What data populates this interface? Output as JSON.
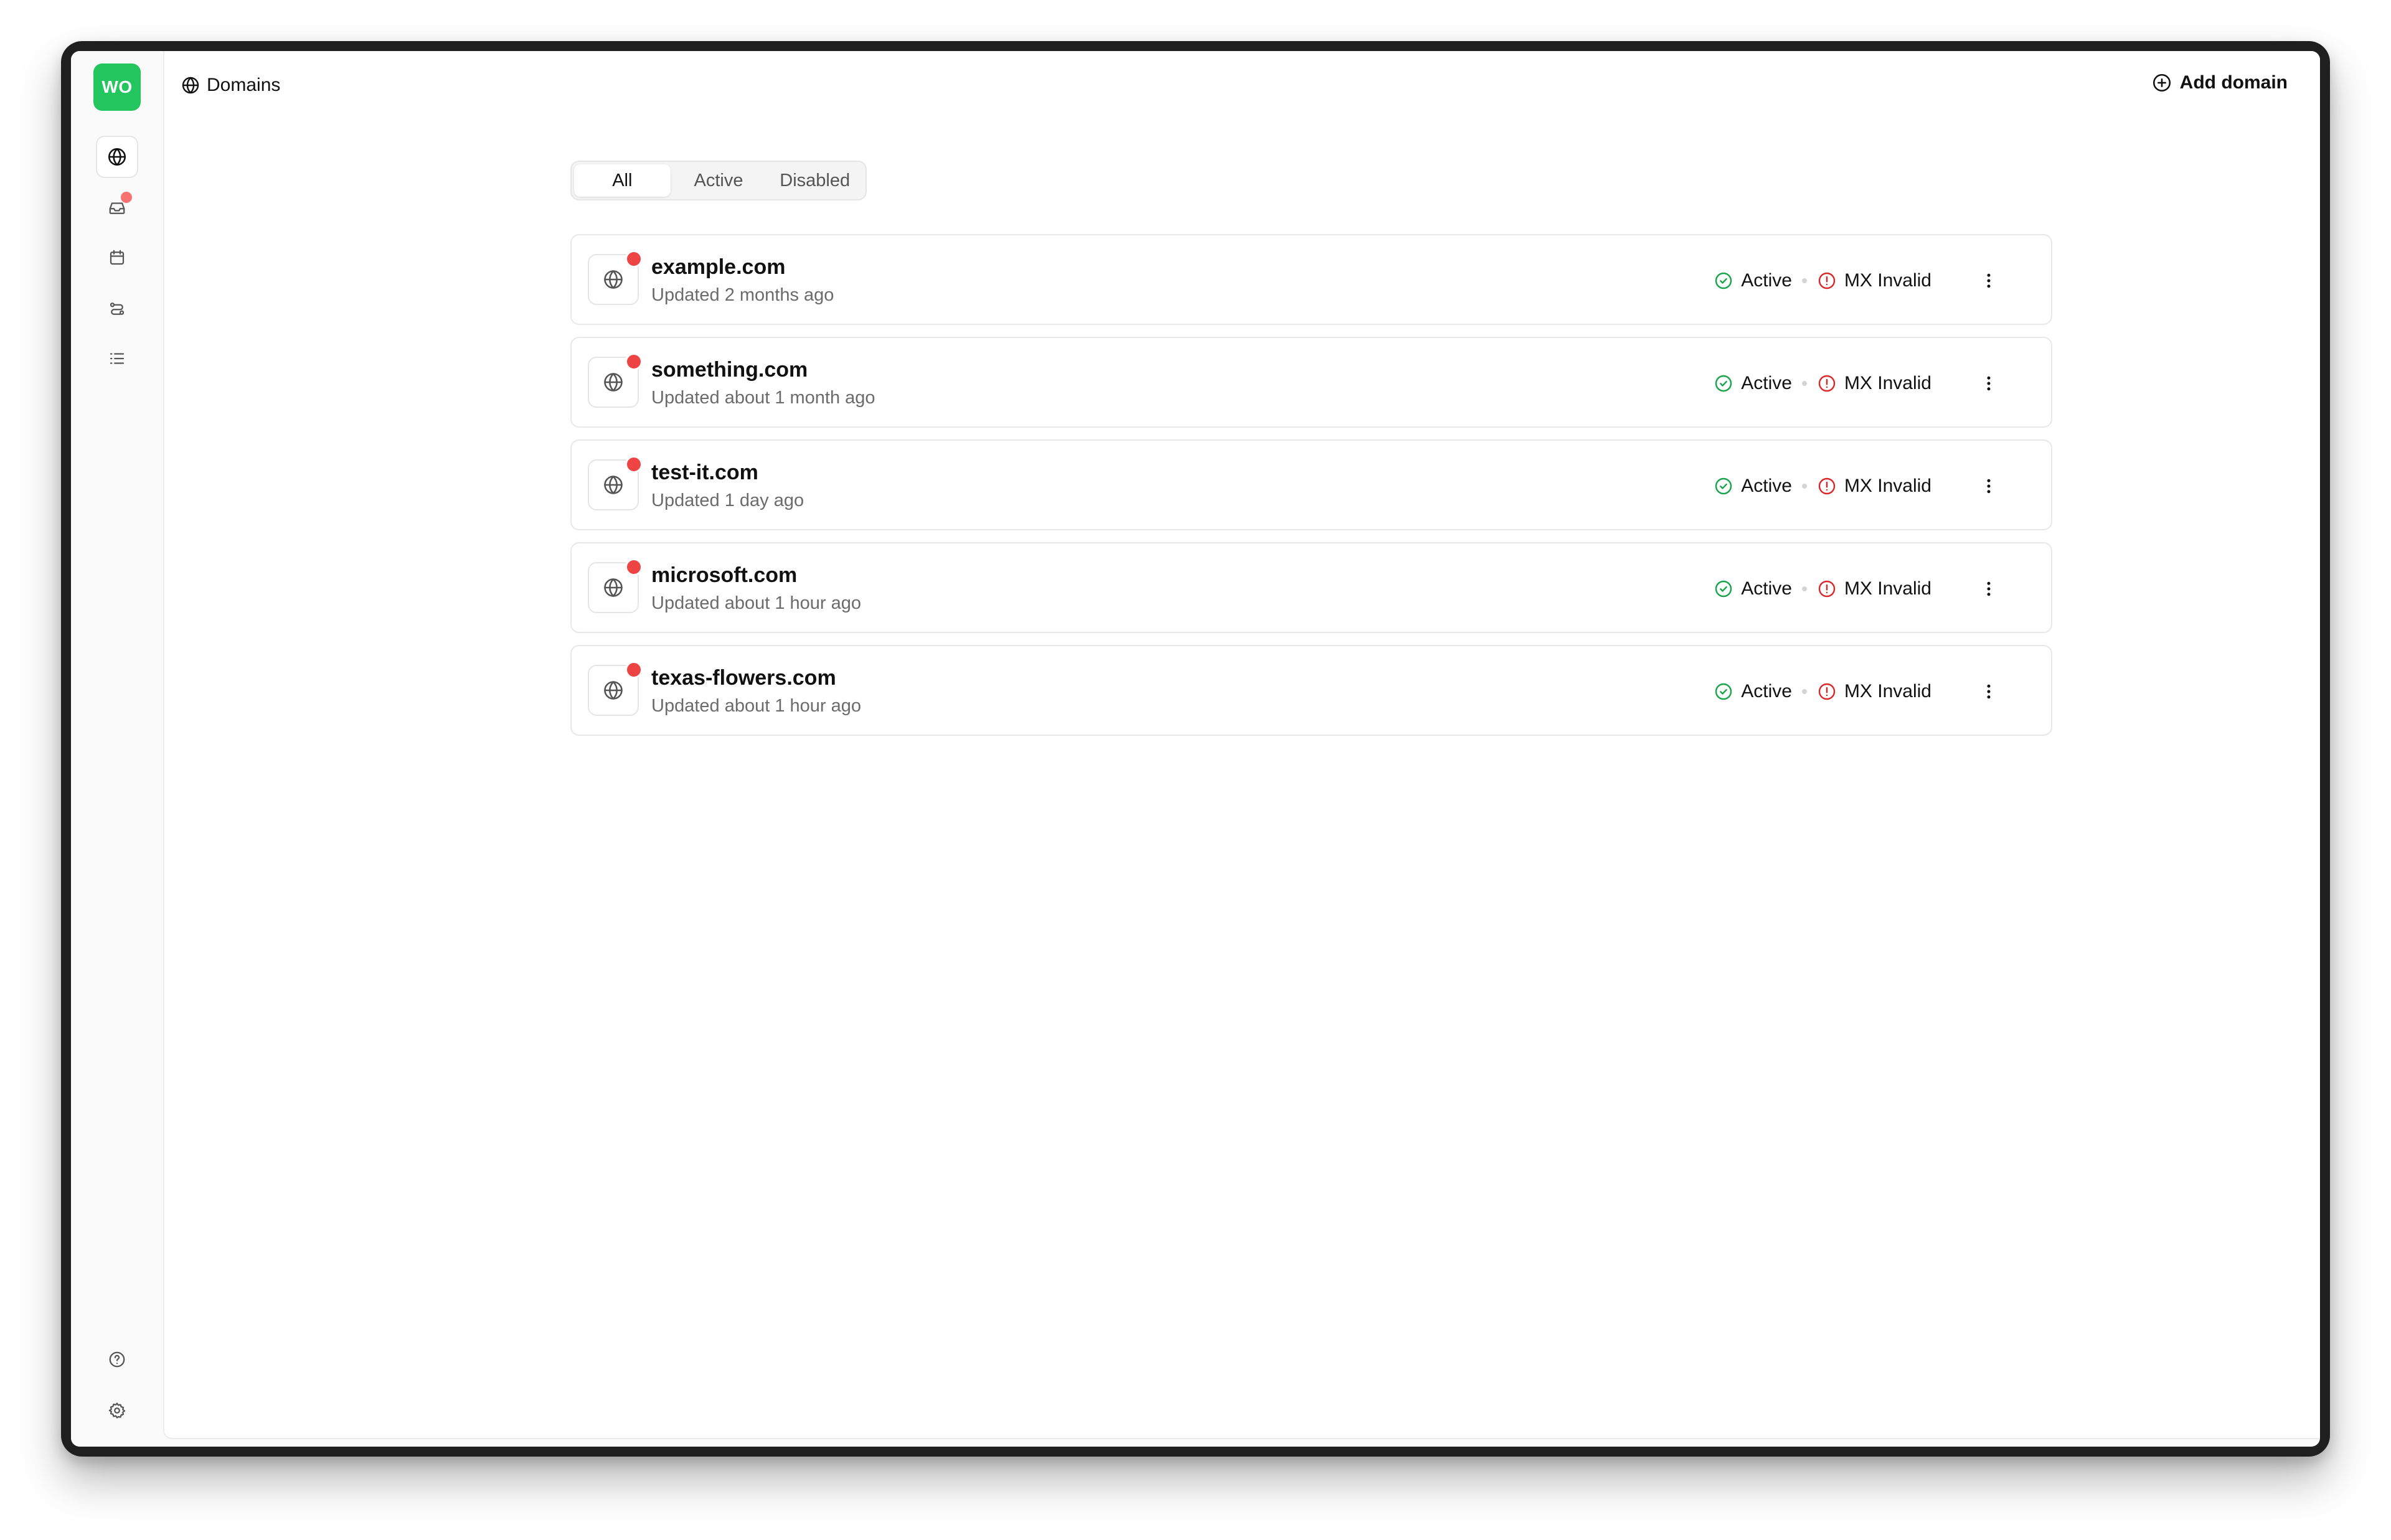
{
  "app": {
    "logo_text": "WO",
    "brand_color": "#22c55e"
  },
  "sidebar": {
    "items": [
      {
        "name": "globe-icon",
        "active": true
      },
      {
        "name": "inbox-icon",
        "badge": true
      },
      {
        "name": "calendar-icon"
      },
      {
        "name": "workflow-icon"
      },
      {
        "name": "list-icon"
      }
    ],
    "bottom_items": [
      {
        "name": "help-icon"
      },
      {
        "name": "settings-icon"
      }
    ]
  },
  "header": {
    "breadcrumb": "Domains",
    "breadcrumb_icon": "globe-icon",
    "add_domain_label": "Add domain",
    "add_domain_icon": "plus-circle-icon"
  },
  "tabs": [
    {
      "label": "All",
      "selected": true
    },
    {
      "label": "Active",
      "selected": false
    },
    {
      "label": "Disabled",
      "selected": false
    }
  ],
  "status_colors": {
    "active": "#16a34a",
    "invalid": "#dc2626",
    "unread_dot": "#ef4444"
  },
  "domains": [
    {
      "name": "example.com",
      "updated": "Updated 2 months ago",
      "status": "Active",
      "mx": "MX Invalid"
    },
    {
      "name": "something.com",
      "updated": "Updated about 1 month ago",
      "status": "Active",
      "mx": "MX Invalid"
    },
    {
      "name": "test-it.com",
      "updated": "Updated 1 day ago",
      "status": "Active",
      "mx": "MX Invalid"
    },
    {
      "name": "microsoft.com",
      "updated": "Updated about 1 hour ago",
      "status": "Active",
      "mx": "MX Invalid"
    },
    {
      "name": "texas-flowers.com",
      "updated": "Updated about 1 hour ago",
      "status": "Active",
      "mx": "MX Invalid"
    }
  ]
}
